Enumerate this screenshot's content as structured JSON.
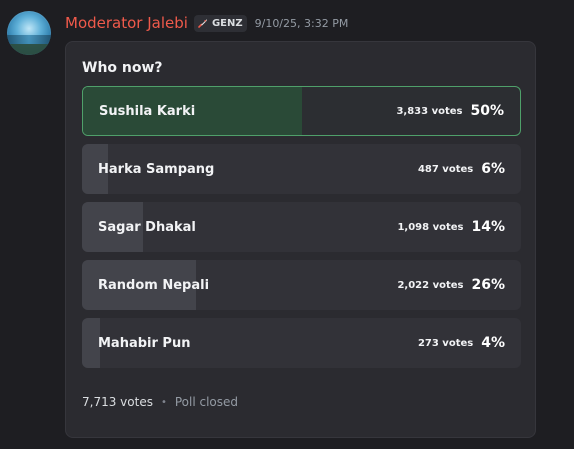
{
  "message": {
    "username": "Moderator Jalebi",
    "tag": {
      "icon": "rocket-icon",
      "label": "GENZ"
    },
    "timestamp": "9/10/25, 3:32 PM",
    "colors": {
      "username": "#f05a4b",
      "winner_border": "#4fa06a"
    }
  },
  "poll": {
    "question": "Who now?",
    "options": [
      {
        "label": "Sushila Karki",
        "votes": "3,833 votes",
        "percent": "50%",
        "share": 0.5,
        "winner": true
      },
      {
        "label": "Harka Sampang",
        "votes": "487 votes",
        "percent": "6%",
        "share": 0.06,
        "winner": false
      },
      {
        "label": "Sagar Dhakal",
        "votes": "1,098 votes",
        "percent": "14%",
        "share": 0.14,
        "winner": false
      },
      {
        "label": "Random Nepali",
        "votes": "2,022 votes",
        "percent": "26%",
        "share": 0.26,
        "winner": false
      },
      {
        "label": "Mahabir Pun",
        "votes": "273 votes",
        "percent": "4%",
        "share": 0.04,
        "winner": false
      }
    ],
    "total_votes": "7,713 votes",
    "status": "Poll closed"
  }
}
